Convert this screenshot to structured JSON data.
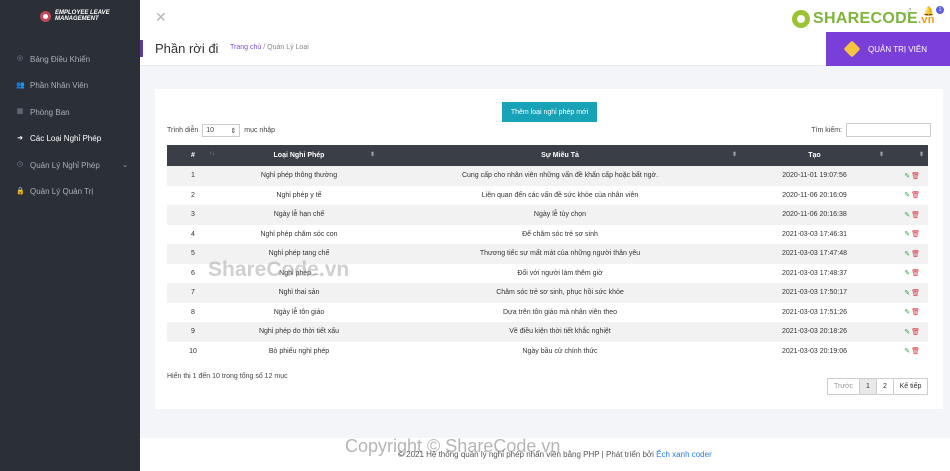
{
  "brand": {
    "name": "EMPLOYEE LEAVE MANAGEMENT"
  },
  "sidebar": {
    "items": [
      {
        "label": "Bảng Điều Khiển",
        "icon": "dashboard-icon"
      },
      {
        "label": "Phần Nhân Viên",
        "icon": "users-icon"
      },
      {
        "label": "Phòng Ban",
        "icon": "grid-icon"
      },
      {
        "label": "Các Loại Nghỉ Phép",
        "icon": "signout-icon",
        "active": true
      },
      {
        "label": "Quản Lý Nghỉ Phép",
        "icon": "clock-icon",
        "has_submenu": true
      },
      {
        "label": "Quản Lý Quản Trị",
        "icon": "lock-icon"
      }
    ]
  },
  "topbar": {
    "logo_text": "SHARECODE",
    "logo_suffix": ".vn",
    "notification_count": "1"
  },
  "header": {
    "title": "Phần rời đi",
    "breadcrumb_home": "Trang chủ",
    "breadcrumb_sep": "/",
    "breadcrumb_current": "Quản Lý Loại",
    "admin_label": "QUẢN TRỊ VIÊN"
  },
  "main": {
    "add_button": "Thêm loại nghỉ phép mới",
    "show_label": "Trình diễn",
    "show_value": "10",
    "entries_label": "mục nhập",
    "search_label": "Tìm kiếm:",
    "columns": [
      "#",
      "Loại Nghỉ Phép",
      "Sự Miêu Tả",
      "Tạo",
      ""
    ],
    "rows": [
      [
        "1",
        "Nghỉ phép thông thường",
        "Cung cấp cho nhân viên những vấn đề khẩn cấp hoặc bất ngờ.",
        "2020-11-01 19:07:56"
      ],
      [
        "2",
        "Nghỉ phép y tế",
        "Liên quan đến các vấn đề sức khỏe của nhân viên",
        "2020-11-06 20:16:09"
      ],
      [
        "3",
        "Ngày lễ hạn chế",
        "Ngày lễ tùy chọn",
        "2020-11-06 20:16:38"
      ],
      [
        "4",
        "Nghỉ phép chăm sóc con",
        "Để chăm sóc trẻ sơ sinh",
        "2021-03-03 17:46:31"
      ],
      [
        "5",
        "Nghỉ phép tang chế",
        "Thương tiếc sự mất mát của những người thân yêu",
        "2021-03-03 17:47:48"
      ],
      [
        "6",
        "Nghỉ phép ...",
        "Đối với người làm thêm giờ",
        "2021-03-03 17:48:37"
      ],
      [
        "7",
        "Nghỉ thai sản",
        "Chăm sóc trẻ sơ sinh, phục hồi sức khỏe",
        "2021-03-03 17:50:17"
      ],
      [
        "8",
        "Ngày lễ tôn giáo",
        "Dựa trên tôn giáo mà nhân viên theo",
        "2021-03-03 17:51:26"
      ],
      [
        "9",
        "Nghỉ phép do thời tiết xấu",
        "Về điều kiện thời tiết khắc nghiệt",
        "2021-03-03 20:18:26"
      ],
      [
        "10",
        "Bỏ phiếu nghỉ phép",
        "Ngày bầu cử chính thức",
        "2021-03-03 20:19:06"
      ]
    ],
    "info": "Hiển thị 1 đến 10 trong tổng số 12 mục",
    "pager": {
      "prev": "Trước",
      "page1": "1",
      "page2": "2",
      "next": "Kế tiếp"
    }
  },
  "footer": {
    "text": "© 2021 Hệ thống quản lý nghỉ phép nhân viên bằng PHP | Phát triển bởi",
    "link": "Ếch xanh coder"
  },
  "watermarks": {
    "center": "ShareCode.vn",
    "bottom": "Copyright © ShareCode.vn"
  }
}
